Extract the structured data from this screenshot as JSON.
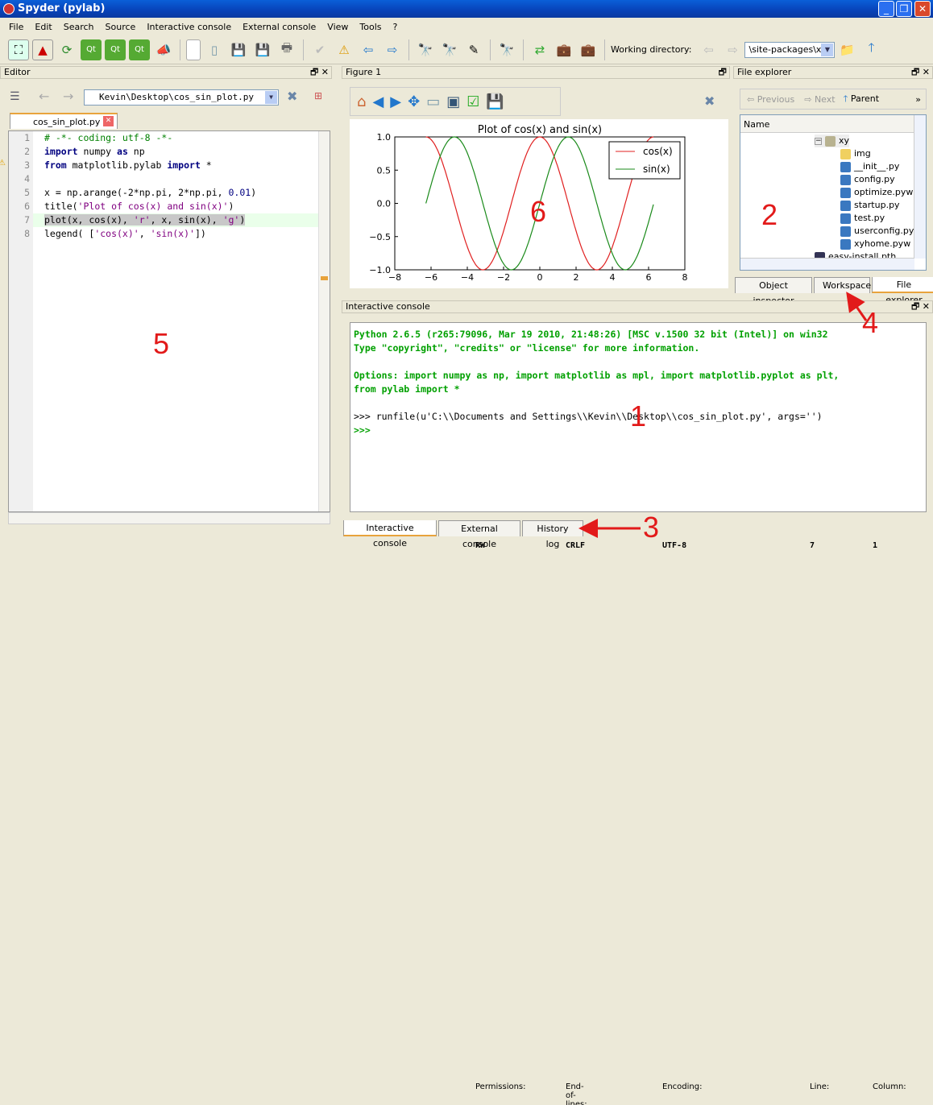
{
  "window": {
    "title": "Spyder (pylab)"
  },
  "menu": [
    "File",
    "Edit",
    "Search",
    "Source",
    "Interactive console",
    "External console",
    "View",
    "Tools",
    "?"
  ],
  "toolbar": {
    "working_dir_label": "Working directory:",
    "working_dir_value": "\\site-packages\\xy"
  },
  "editor": {
    "pane_title": "Editor",
    "file_combo": "Kevin\\Desktop\\cos_sin_plot.py",
    "tab": "cos_sin_plot.py",
    "current_line": 7,
    "warning_line": 3,
    "lines": [
      [
        [
          "# -*- coding: utf-8 -*-",
          "cm"
        ]
      ],
      [
        [
          "import",
          "kw"
        ],
        [
          " numpy ",
          ""
        ],
        [
          "as",
          "kw"
        ],
        [
          " np",
          ""
        ]
      ],
      [
        [
          "from",
          "kw"
        ],
        [
          " matplotlib.pylab ",
          ""
        ],
        [
          "import",
          "kw"
        ],
        [
          " *",
          ""
        ]
      ],
      [],
      [
        [
          "x = np.arange(-2*np.pi, 2*np.pi, ",
          ""
        ],
        [
          "0.01",
          "nm"
        ],
        [
          ")",
          ""
        ]
      ],
      [
        [
          "title(",
          ""
        ],
        [
          "'Plot of cos(x) and sin(x)'",
          "st"
        ],
        [
          ")",
          ""
        ]
      ],
      [
        [
          "plot(x, cos(x), ",
          ""
        ],
        [
          "'r'",
          "st"
        ],
        [
          ", x, sin(x), ",
          ""
        ],
        [
          "'g'",
          "st"
        ],
        [
          ")",
          ""
        ]
      ],
      [
        [
          "legend( [",
          ""
        ],
        [
          "'cos(x)'",
          "st"
        ],
        [
          ", ",
          ""
        ],
        [
          "'sin(x)'",
          "st"
        ],
        [
          "])",
          ""
        ]
      ]
    ]
  },
  "figure": {
    "pane_title": "Figure 1",
    "chart_data": {
      "type": "line",
      "title": "Plot of cos(x) and sin(x)",
      "xlim": [
        -8,
        8
      ],
      "ylim": [
        -1.0,
        1.0
      ],
      "xticks": [
        "−8",
        "−6",
        "−4",
        "−2",
        "0",
        "2",
        "4",
        "6",
        "8"
      ],
      "yticks": [
        "1.0",
        "0.5",
        "0.0",
        "−0.5",
        "−1.0"
      ],
      "x_range": [
        -6.2832,
        6.2832
      ],
      "x_step": 0.01,
      "series": [
        {
          "name": "cos(x)",
          "function": "cos",
          "color": "#e02020"
        },
        {
          "name": "sin(x)",
          "function": "sin",
          "color": "#1a8a1a"
        }
      ],
      "legend": "top-right",
      "grid": false
    }
  },
  "file_explorer": {
    "pane_title": "File explorer",
    "nav": {
      "previous": "Previous",
      "next": "Next",
      "parent": "Parent",
      "more": "»"
    },
    "column": "Name",
    "items": [
      {
        "name": "xy",
        "type": "folder-open"
      },
      {
        "name": "img",
        "type": "folder"
      },
      {
        "name": "__init__.py",
        "type": "python"
      },
      {
        "name": "config.py",
        "type": "python"
      },
      {
        "name": "optimize.pyw",
        "type": "python"
      },
      {
        "name": "startup.py",
        "type": "python"
      },
      {
        "name": "test.py",
        "type": "python"
      },
      {
        "name": "userconfig.py",
        "type": "python"
      },
      {
        "name": "xyhome.pyw",
        "type": "python"
      },
      {
        "name": "easy-install.pth",
        "type": "file"
      }
    ],
    "tabs": [
      "Object inspector",
      "Workspace",
      "File explorer"
    ],
    "active_tab": "File explorer"
  },
  "console": {
    "pane_title": "Interactive console",
    "lines": [
      {
        "text": "Python 2.6.5 (r265:79096, Mar 19 2010, 21:48:26) [MSC v.1500 32 bit (Intel)] on win32",
        "style": "green"
      },
      {
        "text": "Type \"copyright\", \"credits\" or \"license\" for more information.",
        "style": "green"
      },
      {
        "text": "",
        "style": ""
      },
      {
        "text": "Options: import numpy as np, import matplotlib as mpl, import matplotlib.pyplot as plt,",
        "style": "green"
      },
      {
        "text": "from pylab import *",
        "style": "green"
      },
      {
        "text": "",
        "style": ""
      },
      {
        "text": ">>> runfile(u'C:\\\\Documents and Settings\\\\Kevin\\\\Desktop\\\\cos_sin_plot.py', args='')",
        "style": ""
      },
      {
        "text": ">>> ",
        "style": "green"
      }
    ],
    "tabs": [
      "Interactive console",
      "External console",
      "History log"
    ],
    "active_tab": "Interactive console"
  },
  "status": {
    "permissions_label": "Permissions:",
    "permissions": "RW",
    "eol_label": "End-of-lines:",
    "eol": "CRLF",
    "encoding_label": "Encoding:",
    "encoding": "UTF-8",
    "line_label": "Line:",
    "line": "7",
    "column_label": "Column:",
    "column": "1"
  },
  "annotations": [
    "1",
    "2",
    "3",
    "4",
    "5",
    "6"
  ],
  "colors": {
    "title_bar": "#0842b8",
    "annotation": "#e21a1a",
    "console_green": "#00a000",
    "active_tab_accent": "#e8a33c"
  }
}
